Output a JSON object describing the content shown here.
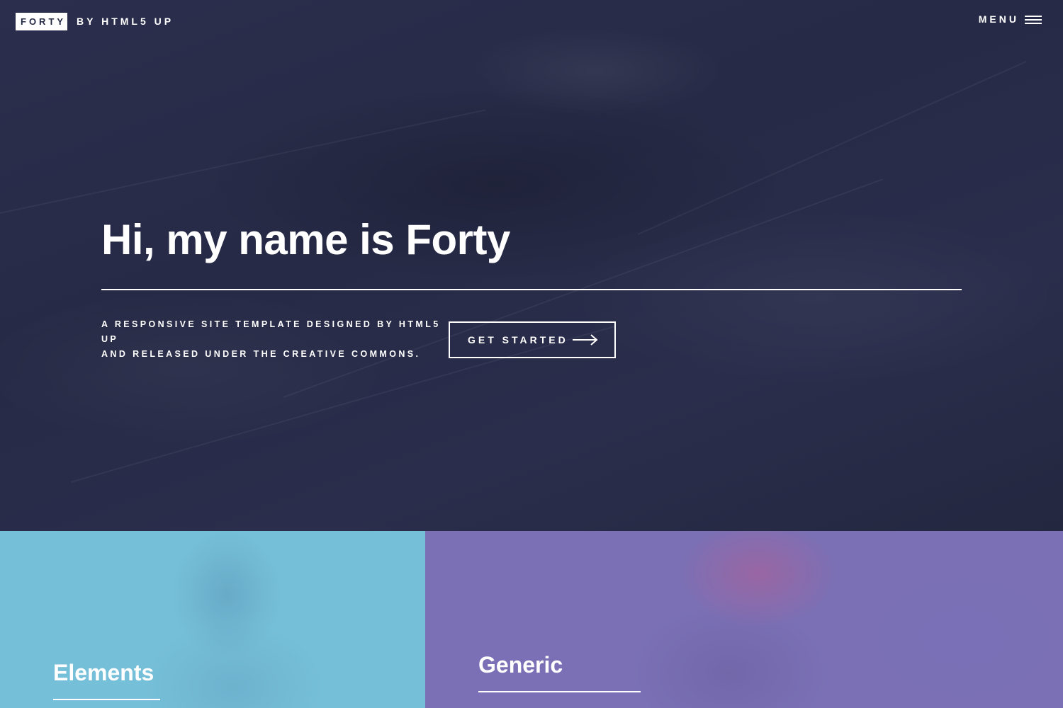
{
  "header": {
    "logo_box": "FORTY",
    "logo_by": "BY HTML5 UP",
    "menu_label": "MENU",
    "menu_icon": "hamburger-icon"
  },
  "banner": {
    "title": "Hi, my name is Forty",
    "text_line1": "A responsive site template designed by HTML5 UP",
    "text_line2": "and released under the Creative Commons.",
    "button_label": "GET STARTED",
    "button_icon": "arrow-right-icon"
  },
  "tiles": [
    {
      "heading": "Elements",
      "color": "#76bfd8"
    },
    {
      "heading": "Generic",
      "color": "#7b70b5"
    }
  ],
  "colors": {
    "background": "#242943",
    "text": "#ffffff"
  }
}
